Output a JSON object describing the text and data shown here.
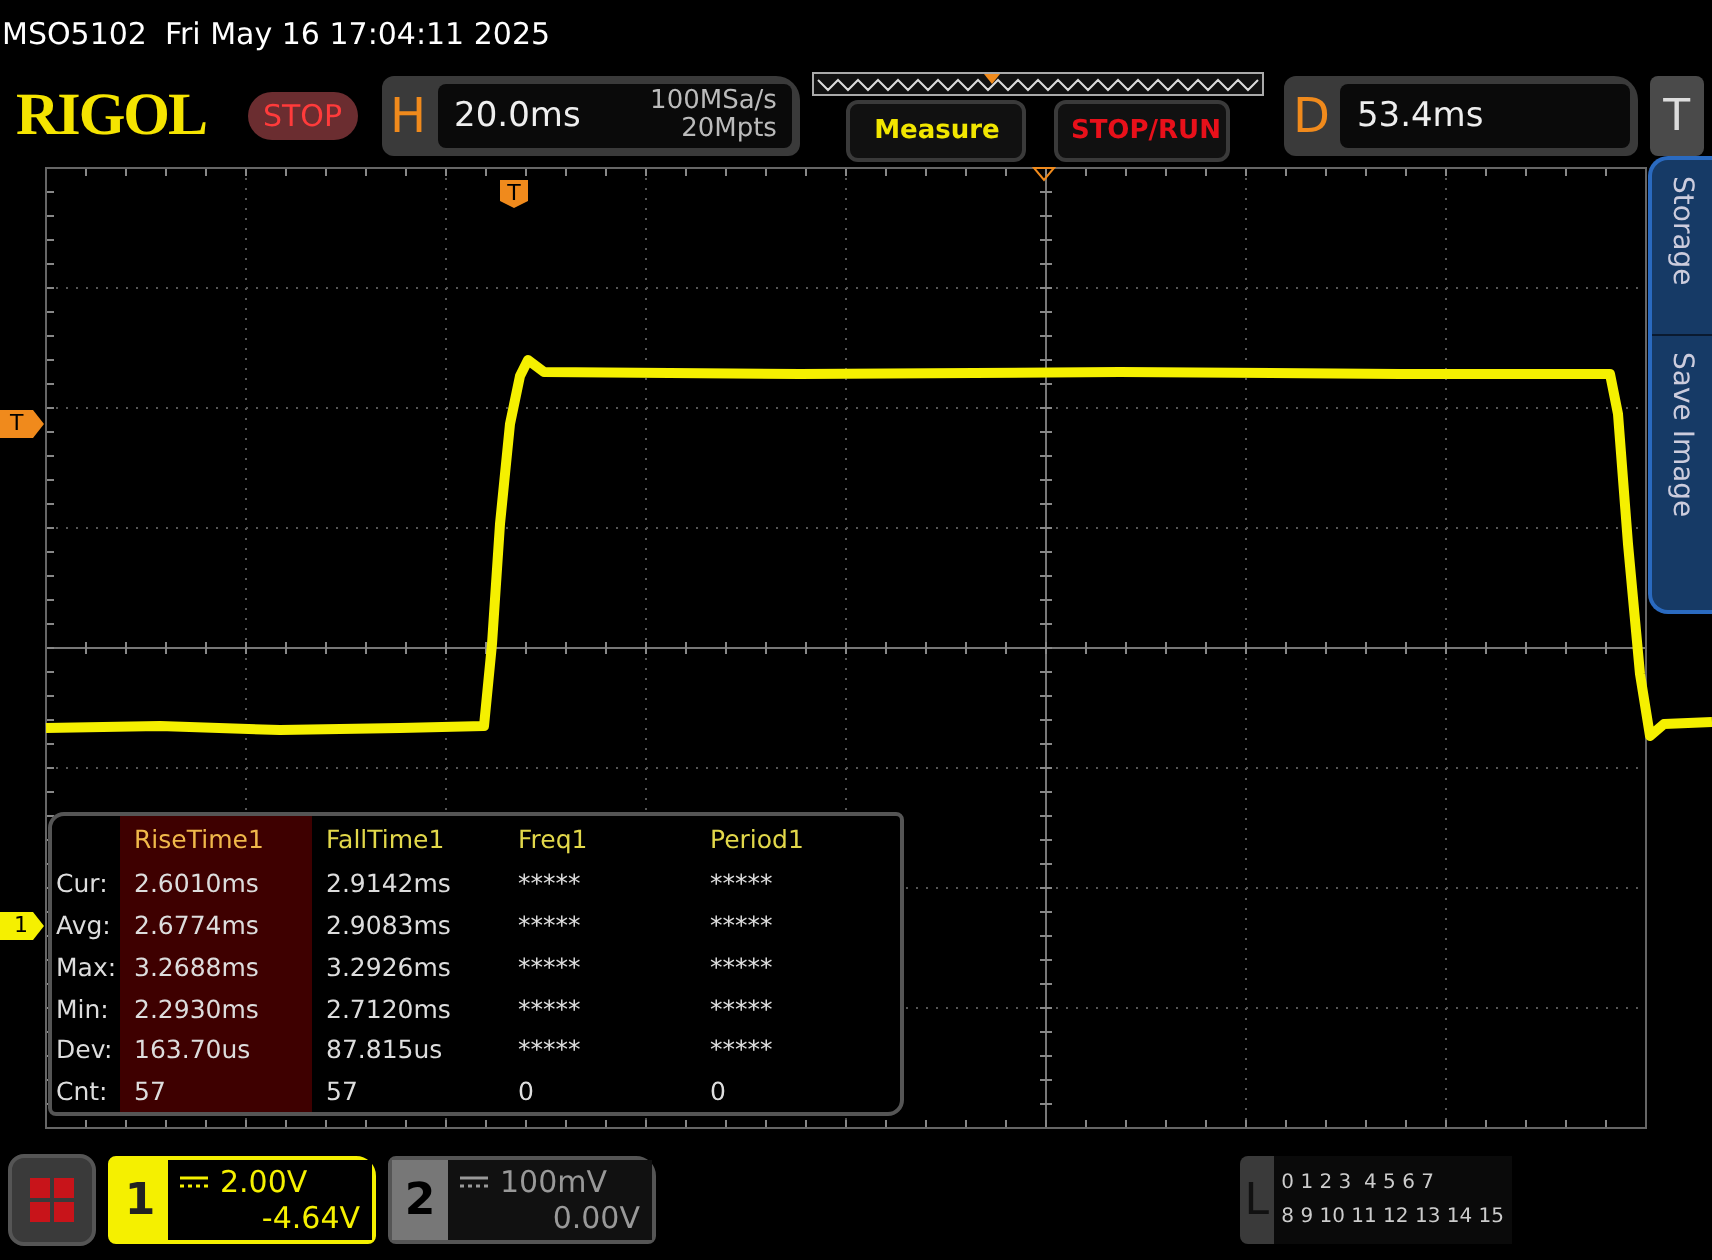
{
  "status_bar": {
    "model": "MSO5102",
    "datetime": "Fri May 16 17:04:11 2025"
  },
  "toolbar": {
    "logo": "RIGOL",
    "run_state": "STOP",
    "horizontal": {
      "label": "H",
      "timebase": "20.0ms",
      "sample_rate": "100MSa/s",
      "memory_depth": "20Mpts"
    },
    "buttons": [
      {
        "label": "Measure",
        "kind": "measure"
      },
      {
        "label": "STOP/RUN",
        "kind": "run"
      }
    ],
    "delay": {
      "label": "D",
      "value": "53.4ms"
    },
    "touch_button": "T"
  },
  "side_tabs": [
    "Storage",
    "Save Image"
  ],
  "markers": {
    "trigger_position": "T",
    "trigger_level": "T",
    "channel": "1"
  },
  "measurements": {
    "columns": [
      {
        "label": "RiseTime1",
        "selected": true
      },
      {
        "label": "FallTime1",
        "selected": false
      },
      {
        "label": "Freq1",
        "selected": false
      },
      {
        "label": "Period1",
        "selected": false
      }
    ],
    "rows": [
      {
        "label": "Cur:",
        "values": [
          "2.6010ms",
          "2.9142ms",
          "*****",
          "*****"
        ]
      },
      {
        "label": "Avg:",
        "values": [
          "2.6774ms",
          "2.9083ms",
          "*****",
          "*****"
        ]
      },
      {
        "label": "Max:",
        "values": [
          "3.2688ms",
          "3.2926ms",
          "*****",
          "*****"
        ]
      },
      {
        "label": "Min:",
        "values": [
          "2.2930ms",
          "2.7120ms",
          "*****",
          "*****"
        ]
      },
      {
        "label": "Dev:",
        "values": [
          "163.70us",
          "87.815us",
          "*****",
          "*****"
        ]
      },
      {
        "label": "Cnt:",
        "values": [
          "57",
          "57",
          "0",
          "0"
        ]
      }
    ]
  },
  "channels": [
    {
      "number": "1",
      "scale": "2.00V",
      "offset": "-4.64V",
      "selected": true
    },
    {
      "number": "2",
      "scale": "100mV",
      "offset": "0.00V",
      "selected": false
    }
  ],
  "logic": {
    "label": "L",
    "rows": [
      "0 1 2 3  4 5 6 7",
      "8 9 10 11 12 13 14 15"
    ]
  }
}
